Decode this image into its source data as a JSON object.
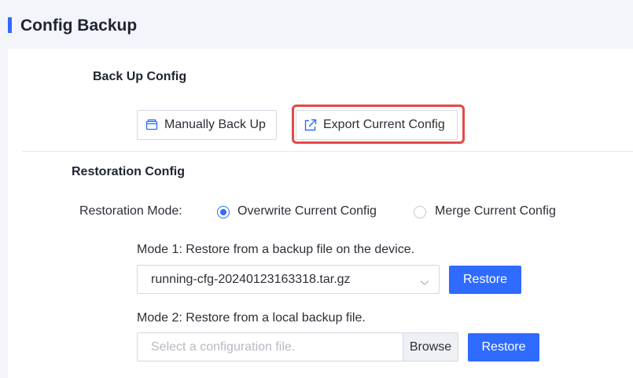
{
  "page": {
    "title": "Config Backup"
  },
  "backup": {
    "section_title": "Back Up Config",
    "manual_label": "Manually Back Up",
    "export_label": "Export Current Config"
  },
  "restoration": {
    "section_title": "Restoration Config",
    "mode_label": "Restoration Mode:",
    "options": [
      {
        "label": "Overwrite Current Config",
        "checked": true
      },
      {
        "label": "Merge Current Config",
        "checked": false
      }
    ],
    "mode1": {
      "label": "Mode 1: Restore from a backup file on the device.",
      "selected_file": "running-cfg-20240123163318.tar.gz",
      "restore_label": "Restore"
    },
    "mode2": {
      "label": "Mode 2: Restore from a local backup file.",
      "placeholder": "Select a configuration file.",
      "browse_label": "Browse",
      "restore_label": "Restore"
    }
  },
  "colors": {
    "accent": "#2f6bff",
    "highlight": "#e54848"
  }
}
